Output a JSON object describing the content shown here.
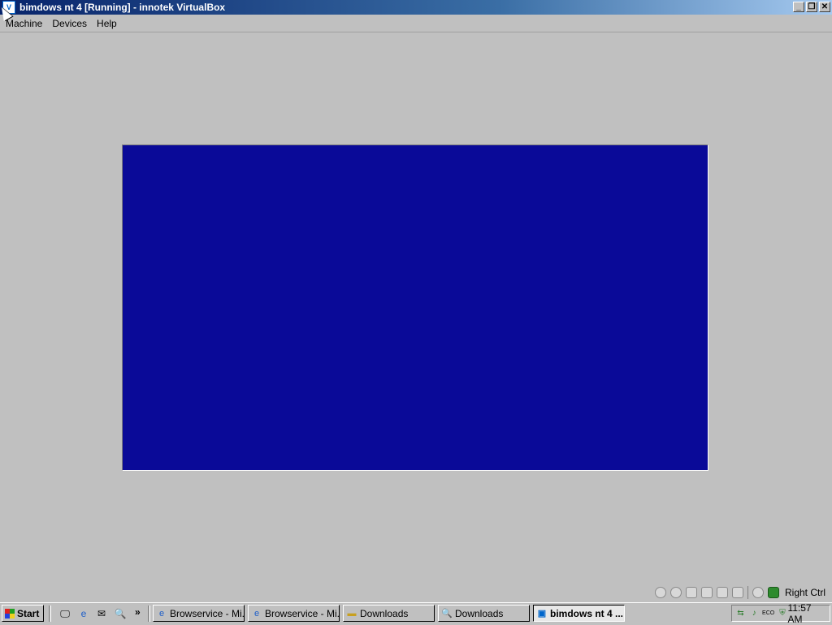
{
  "window": {
    "title": "bimdows nt 4 [Running] - innotek VirtualBox",
    "buttons": {
      "minimize": "_",
      "maximize": "❐",
      "close": "✕"
    }
  },
  "menu": [
    "Machine",
    "Devices",
    "Help"
  ],
  "vm_screen": {
    "color": "#0a0a98"
  },
  "statusbar": {
    "icons": [
      "hard-disk-icon",
      "cd-icon",
      "floppy-icon",
      "network-icon",
      "usb-icon",
      "shared-folder-icon",
      "mouse-integration-icon",
      "host-key-icon"
    ],
    "host_key_label": "Right Ctrl"
  },
  "taskbar": {
    "start_label": "Start",
    "quick_launch": [
      "show-desktop-icon",
      "internet-explorer-icon",
      "outlook-icon",
      "explorer-search-icon"
    ],
    "tasks": [
      {
        "label": "Browservice - Mi...",
        "icon": "ie-icon",
        "active": false
      },
      {
        "label": "Browservice - Mi...",
        "icon": "ie-icon",
        "active": false
      },
      {
        "label": "Downloads",
        "icon": "folder-icon",
        "active": false
      },
      {
        "label": "Downloads",
        "icon": "search-folder-icon",
        "active": false
      },
      {
        "label": "bimdows nt 4 ...",
        "icon": "virtualbox-icon",
        "active": true
      }
    ],
    "tray_icons": [
      "network-tray-icon",
      "speaker-tray-icon",
      "eco-tray-icon",
      "shield-tray-icon"
    ],
    "tray_eco_text": "ECO",
    "clock": "11:57 AM"
  },
  "colors": {
    "title_start": "#08246b",
    "title_end": "#a6caf0",
    "desktop": "#c0c0c0"
  }
}
